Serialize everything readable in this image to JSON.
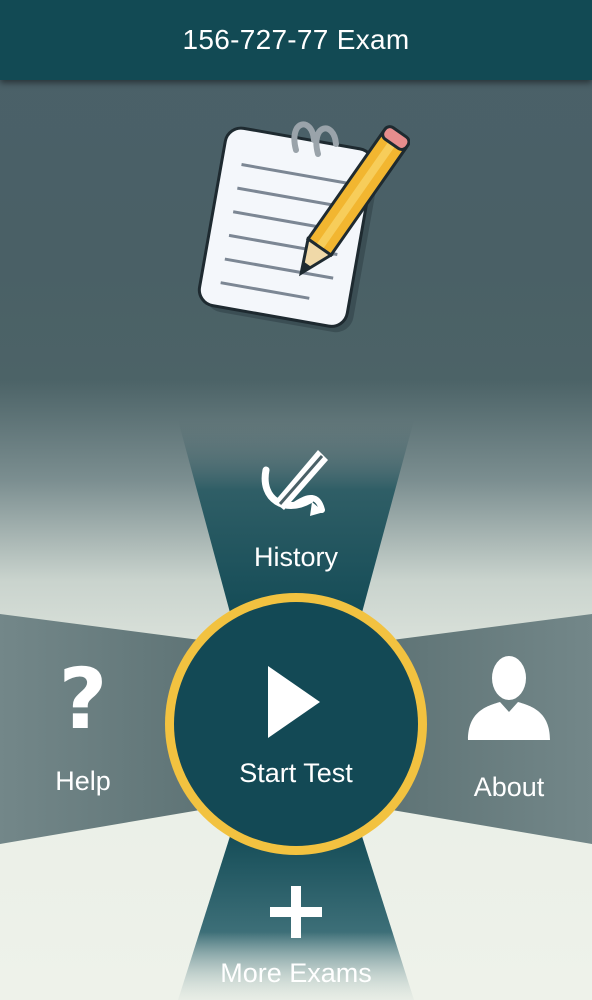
{
  "header": {
    "title": "156-727-77 Exam"
  },
  "menu": {
    "history_label": "History",
    "help_label": "Help",
    "start_label": "Start Test",
    "about_label": "About",
    "more_label": "More Exams",
    "help_glyph": "?"
  },
  "icons": {
    "logo": "notepad-pencil-icon",
    "history": "signature-pen-icon",
    "help": "question-mark-icon",
    "start": "play-icon",
    "about": "person-silhouette-icon",
    "more": "plus-icon"
  },
  "colors": {
    "header_bg": "#124a54",
    "center_fill": "#134955",
    "ring": "#f2c240",
    "ray_teal": "#14505b",
    "side_panel": "#6f8385"
  }
}
